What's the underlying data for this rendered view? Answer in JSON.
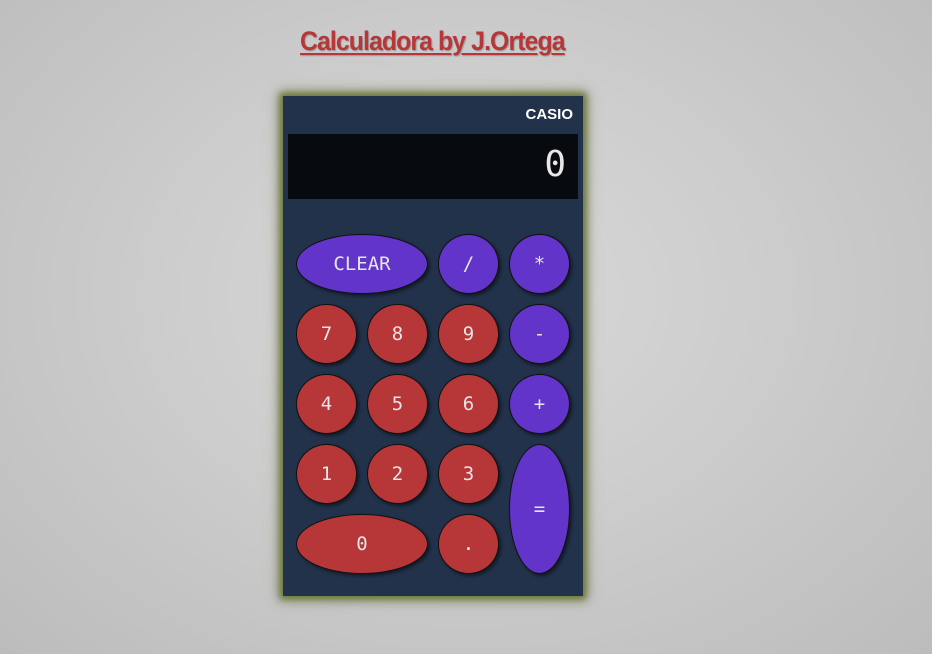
{
  "page": {
    "title": "Calculadora by J.Ortega"
  },
  "calculator": {
    "brand": "CASIO",
    "display": "0",
    "buttons": {
      "clear": "CLEAR",
      "divide": "/",
      "multiply": "*",
      "seven": "7",
      "eight": "8",
      "nine": "9",
      "minus": "-",
      "four": "4",
      "five": "5",
      "six": "6",
      "plus": "+",
      "one": "1",
      "two": "2",
      "three": "3",
      "equals": "=",
      "zero": "0",
      "dot": "."
    }
  },
  "colors": {
    "title": "#b73739",
    "operator_button": "#6234c9",
    "number_button": "#b73739",
    "body": "#22324a",
    "display": "#070b10"
  }
}
